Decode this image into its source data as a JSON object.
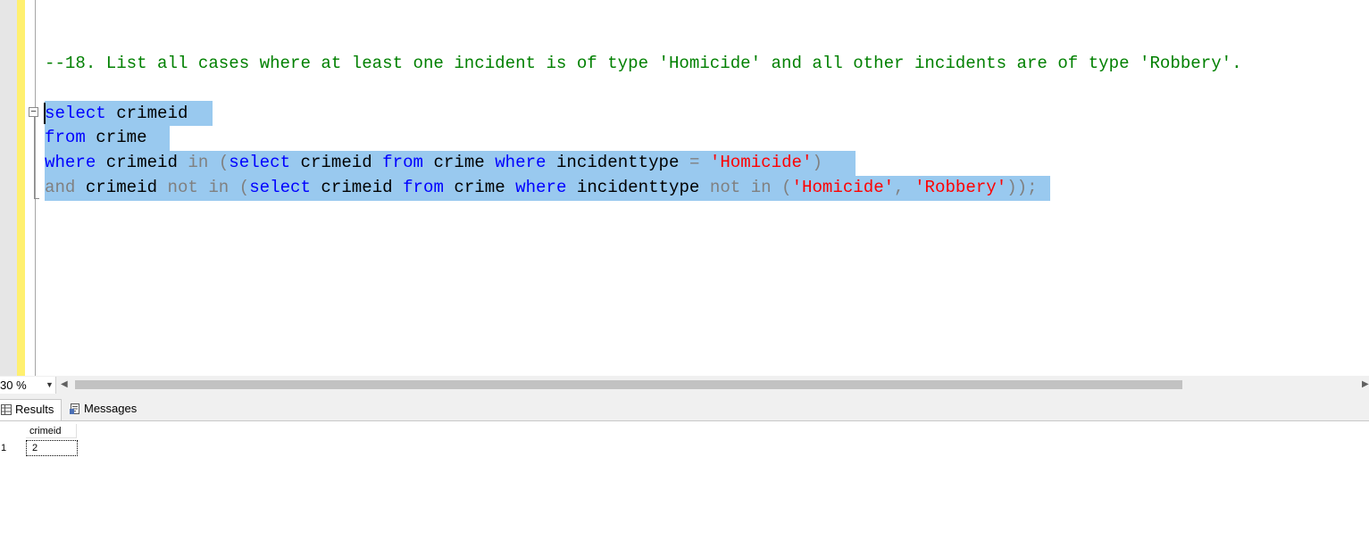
{
  "editor": {
    "comment": "--18. List all cases where at least one incident is of type 'Homicide' and all other incidents are of type 'Robbery'.",
    "fold_symbol": "−",
    "lines": [
      [
        {
          "t": "select",
          "c": "kw"
        },
        {
          "t": " crimeid",
          "c": "plain"
        }
      ],
      [
        {
          "t": "from",
          "c": "kw"
        },
        {
          "t": " crime",
          "c": "plain"
        }
      ],
      [
        {
          "t": "where",
          "c": "kw"
        },
        {
          "t": " crimeid ",
          "c": "plain"
        },
        {
          "t": "in",
          "c": "gray"
        },
        {
          "t": " ",
          "c": "plain"
        },
        {
          "t": "(",
          "c": "gray"
        },
        {
          "t": "select",
          "c": "kw"
        },
        {
          "t": " crimeid ",
          "c": "plain"
        },
        {
          "t": "from",
          "c": "kw"
        },
        {
          "t": " crime ",
          "c": "plain"
        },
        {
          "t": "where",
          "c": "kw"
        },
        {
          "t": " incidenttype ",
          "c": "plain"
        },
        {
          "t": "=",
          "c": "gray"
        },
        {
          "t": " ",
          "c": "plain"
        },
        {
          "t": "'Homicide'",
          "c": "str"
        },
        {
          "t": ")",
          "c": "gray"
        }
      ],
      [
        {
          "t": "and",
          "c": "gray"
        },
        {
          "t": " crimeid ",
          "c": "plain"
        },
        {
          "t": "not",
          "c": "gray"
        },
        {
          "t": " ",
          "c": "plain"
        },
        {
          "t": "in",
          "c": "gray"
        },
        {
          "t": " ",
          "c": "plain"
        },
        {
          "t": "(",
          "c": "gray"
        },
        {
          "t": "select",
          "c": "kw"
        },
        {
          "t": " crimeid ",
          "c": "plain"
        },
        {
          "t": "from",
          "c": "kw"
        },
        {
          "t": " crime ",
          "c": "plain"
        },
        {
          "t": "where",
          "c": "kw"
        },
        {
          "t": " incidenttype ",
          "c": "plain"
        },
        {
          "t": "not",
          "c": "gray"
        },
        {
          "t": " ",
          "c": "plain"
        },
        {
          "t": "in",
          "c": "gray"
        },
        {
          "t": " ",
          "c": "plain"
        },
        {
          "t": "(",
          "c": "gray"
        },
        {
          "t": "'Homicide'",
          "c": "str"
        },
        {
          "t": ", ",
          "c": "gray"
        },
        {
          "t": "'Robbery'",
          "c": "str"
        },
        {
          "t": "));",
          "c": "gray"
        }
      ]
    ]
  },
  "zoom": {
    "value": "30 %"
  },
  "tabs": {
    "results": "Results",
    "messages": "Messages"
  },
  "grid": {
    "columns": [
      "crimeid"
    ],
    "rows": [
      {
        "num": "1",
        "cells": [
          "2"
        ]
      }
    ]
  },
  "colors": {
    "keyword": "#0000ff",
    "comment": "#008000",
    "string": "#ff0000",
    "operator": "#808080",
    "selection": "#99c9ef",
    "change_bar": "#fff06f"
  }
}
